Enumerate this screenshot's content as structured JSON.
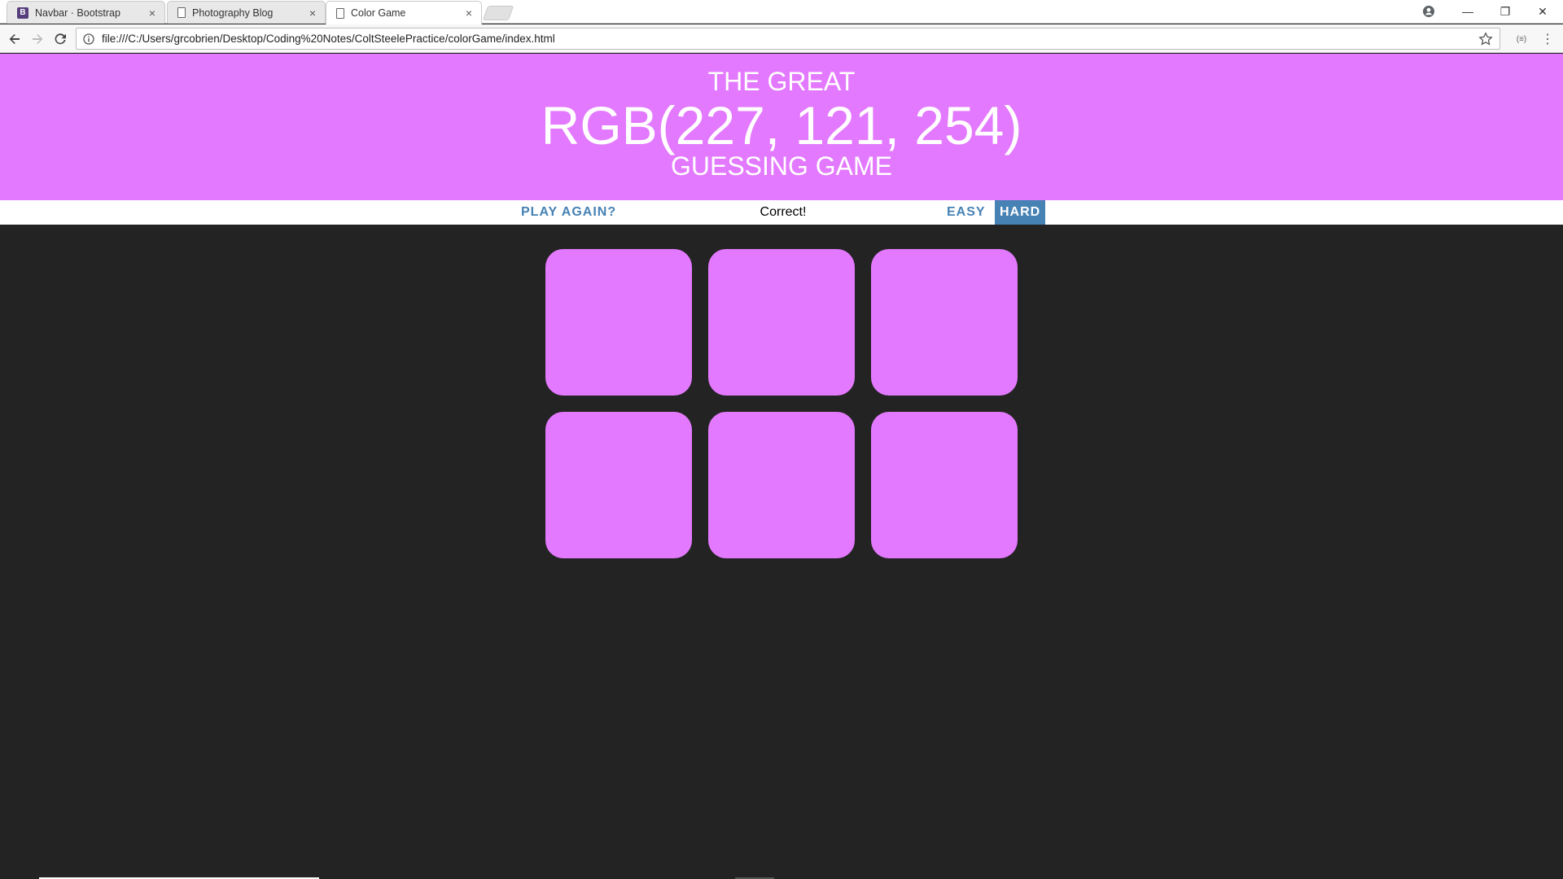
{
  "browser": {
    "tabs": [
      {
        "title": "Navbar · Bootstrap",
        "favicon": "bootstrap-icon",
        "favicon_glyph": "B",
        "close": "×"
      },
      {
        "title": "Photography Blog",
        "favicon": "document-icon",
        "close": "×"
      },
      {
        "title": "Color Game",
        "favicon": "document-icon",
        "close": "×",
        "active": true
      }
    ],
    "url": "file:///C:/Users/grcobrien/Desktop/Coding%20Notes/ColtSteelePractice/colorGame/index.html",
    "window_controls": [
      "account-icon",
      "minimize-icon",
      "restore-icon",
      "close-icon"
    ],
    "toolbar_icons": [
      "back-arrow-icon",
      "forward-arrow-icon",
      "reload-icon",
      "info-icon",
      "star-icon",
      "extension-icon",
      "menu-kebab-icon"
    ],
    "extension_label": "(≡)",
    "menu_glyph": "⋮",
    "minimize_glyph": "—",
    "restore_glyph": "❐",
    "close_glyph": "✕"
  },
  "game": {
    "header": {
      "line1": "THE GREAT",
      "color_display": "RGB(227, 121, 254)",
      "line3": "GUESSING GAME"
    },
    "stripe": {
      "reset_label": "PLAY AGAIN?",
      "message": "Correct!",
      "easy_label": "EASY",
      "hard_label": "HARD",
      "selected_mode": "HARD"
    },
    "squares": [
      "#e379fe",
      "#e379fe",
      "#e379fe",
      "#e379fe",
      "#e379fe",
      "#e379fe"
    ],
    "colors": {
      "header_bg": "#e379fe",
      "page_bg": "#232323",
      "accent": "#4682b4"
    }
  }
}
